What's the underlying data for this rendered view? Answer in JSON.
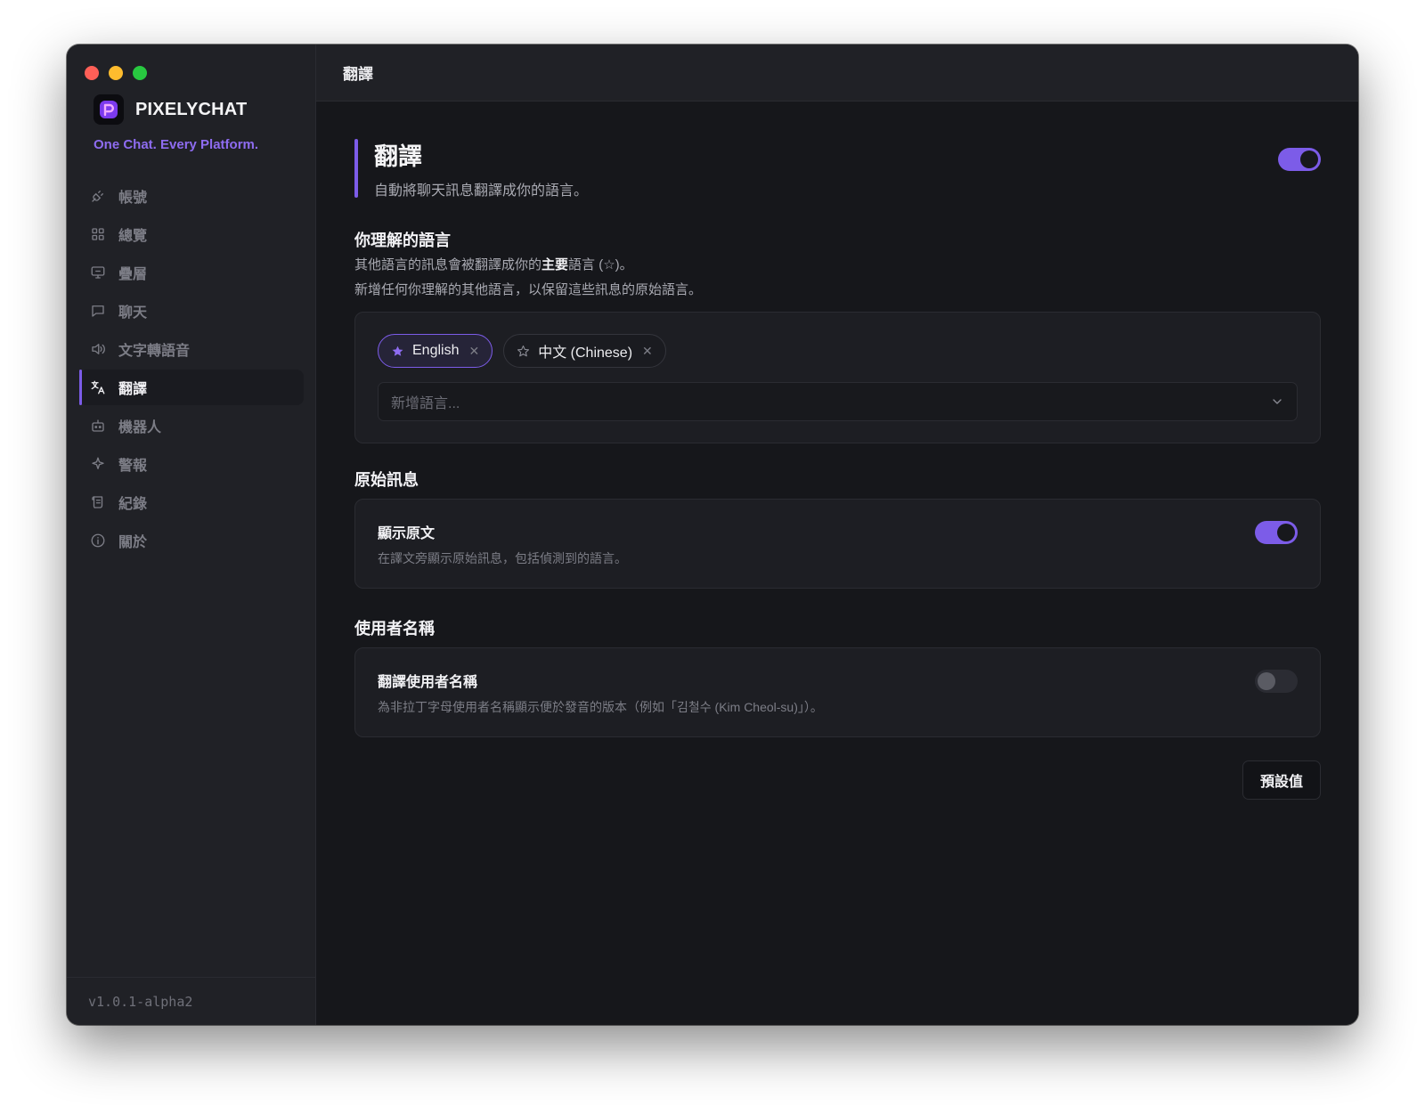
{
  "app": {
    "brand": "PIXELYCHAT",
    "tagline": "One Chat. Every Platform.",
    "version": "v1.0.1-alpha2",
    "accent_color": "#7c5ce8"
  },
  "sidebar": {
    "items": [
      {
        "label": "帳號",
        "icon": "plug-icon",
        "active": false
      },
      {
        "label": "總覽",
        "icon": "grid-icon",
        "active": false
      },
      {
        "label": "疊層",
        "icon": "monitor-icon",
        "active": false
      },
      {
        "label": "聊天",
        "icon": "chat-bubble-icon",
        "active": false
      },
      {
        "label": "文字轉語音",
        "icon": "speaker-icon",
        "active": false
      },
      {
        "label": "翻譯",
        "icon": "translate-icon",
        "active": true
      },
      {
        "label": "機器人",
        "icon": "bot-icon",
        "active": false
      },
      {
        "label": "警報",
        "icon": "sparkle-icon",
        "active": false
      },
      {
        "label": "紀錄",
        "icon": "scroll-icon",
        "active": false
      },
      {
        "label": "關於",
        "icon": "info-icon",
        "active": false
      }
    ]
  },
  "topbar": {
    "title": "翻譯"
  },
  "page": {
    "title": "翻譯",
    "description": "自動將聊天訊息翻譯成你的語言。",
    "enabled": true
  },
  "languages": {
    "title": "你理解的語言",
    "line1_before": "其他語言的訊息會被翻譯成你的",
    "line1_bold": "主要",
    "line1_after": "語言 (☆)。",
    "line2": "新增任何你理解的其他語言，以保留這些訊息的原始語言。",
    "chips": [
      {
        "label": "English",
        "primary": true
      },
      {
        "label": "中文 (Chinese)",
        "primary": false
      }
    ],
    "add_placeholder": "新增語言..."
  },
  "original": {
    "section_title": "原始訊息",
    "row_title": "顯示原文",
    "row_desc": "在譯文旁顯示原始訊息，包括偵測到的語言。",
    "enabled": true
  },
  "usernames": {
    "section_title": "使用者名稱",
    "row_title": "翻譯使用者名稱",
    "row_desc": "為非拉丁字母使用者名稱顯示便於發音的版本（例如「김철수 (Kim Cheol-su)」）。",
    "enabled": false
  },
  "actions": {
    "defaults_label": "預設值"
  }
}
